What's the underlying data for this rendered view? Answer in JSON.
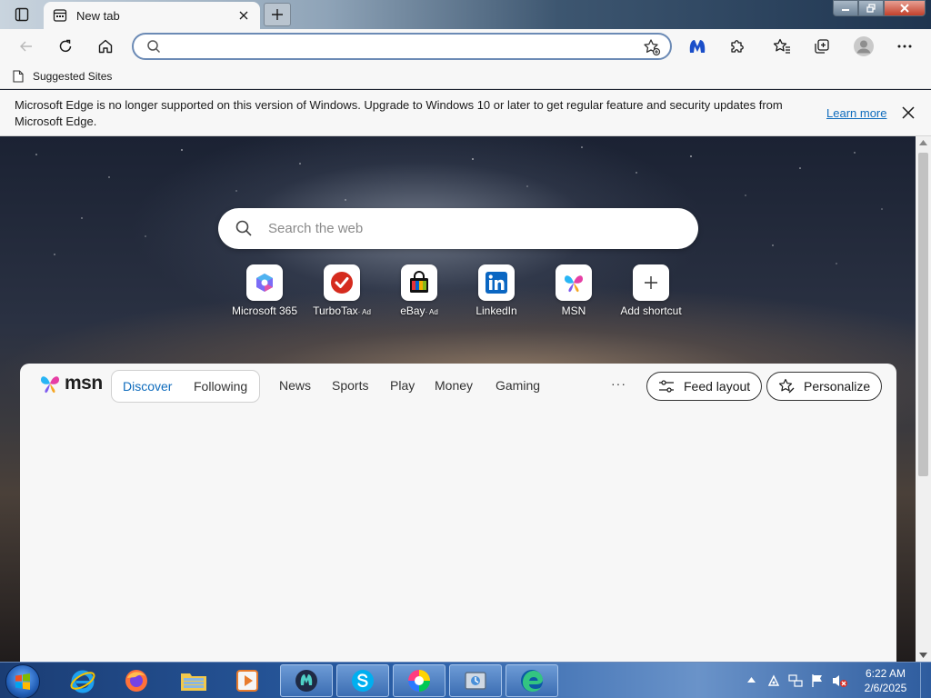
{
  "browser": {
    "tab": {
      "title": "New tab"
    },
    "address": {
      "placeholder": ""
    },
    "favorites_bar": {
      "item": "Suggested Sites"
    }
  },
  "infobar": {
    "message": "Microsoft Edge is no longer supported on this version of Windows. Upgrade to Windows 10 or later to get regular feature and security updates from Microsoft Edge.",
    "link": "Learn more"
  },
  "newtab": {
    "search_placeholder": "Search the web",
    "shortcuts": [
      {
        "label": "Microsoft 365",
        "ad": ""
      },
      {
        "label": "TurboTax",
        "ad": "· Ad"
      },
      {
        "label": "eBay",
        "ad": "· Ad"
      },
      {
        "label": "LinkedIn",
        "ad": ""
      },
      {
        "label": "MSN",
        "ad": ""
      },
      {
        "label": "Add shortcut",
        "ad": ""
      }
    ]
  },
  "feed": {
    "logo": "msn",
    "toggle": [
      "Discover",
      "Following"
    ],
    "nav": [
      "News",
      "Sports",
      "Play",
      "Money",
      "Gaming"
    ],
    "more": "···",
    "feed_layout": "Feed layout",
    "personalize": "Personalize"
  },
  "taskbar": {
    "apps": [
      "Internet Explorer",
      "Firefox",
      "File Explorer",
      "Media Player",
      "Malwarebytes",
      "Skype",
      "Color app",
      "Utility",
      "Microsoft Edge"
    ],
    "time": "6:22 AM",
    "date": "2/6/2025"
  },
  "colors": {
    "accent": "#0f6cbd",
    "taskbar": "#2a5fa8"
  }
}
